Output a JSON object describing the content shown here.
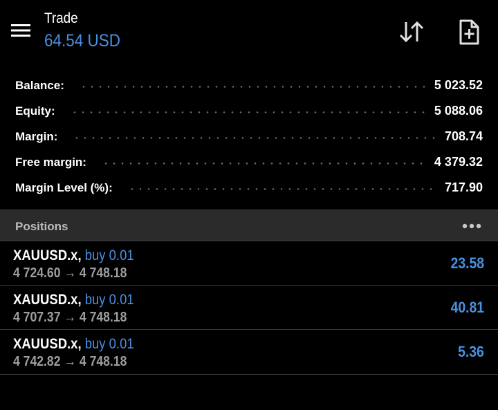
{
  "header": {
    "title": "Trade",
    "profit_total": "64.54 USD",
    "icons": {
      "menu": "hamburger-menu-icon",
      "sort": "sort-arrows-icon",
      "new_order": "new-document-plus-icon"
    },
    "accent_color": "#4a90e2"
  },
  "summary": [
    {
      "label": "Balance:",
      "value": "5 023.52"
    },
    {
      "label": "Equity:",
      "value": "5 088.06"
    },
    {
      "label": "Margin:",
      "value": "708.74"
    },
    {
      "label": "Free margin:",
      "value": "4 379.32"
    },
    {
      "label": "Margin Level (%):",
      "value": "717.90"
    }
  ],
  "positions": {
    "title": "Positions",
    "more_icon": "more-dots-icon",
    "items": [
      {
        "symbol": "XAUUSD.x,",
        "side": "buy 0.01",
        "prices": "4 724.60 → 4 748.18",
        "profit": "23.58"
      },
      {
        "symbol": "XAUUSD.x,",
        "side": "buy 0.01",
        "prices": "4 707.37 → 4 748.18",
        "profit": "40.81"
      },
      {
        "symbol": "XAUUSD.x,",
        "side": "buy 0.01",
        "prices": "4 742.82 → 4 748.18",
        "profit": "5.36"
      }
    ]
  }
}
